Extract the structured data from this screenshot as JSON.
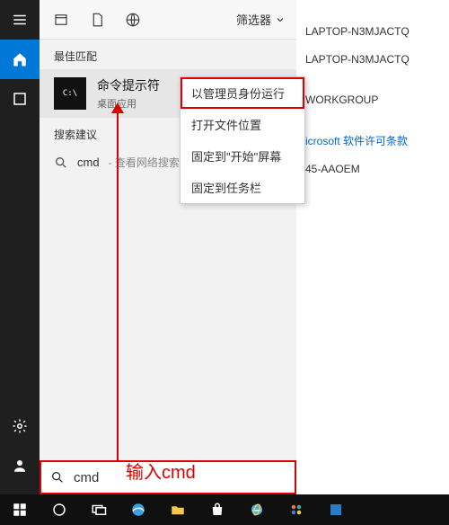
{
  "bg": {
    "line1": "LAPTOP-N3MJACTQ",
    "line2": "LAPTOP-N3MJACTQ",
    "line3": "WORKGROUP",
    "line4_link": "icrosoft 软件许可条款",
    "line5": "45-AAOEM"
  },
  "header": {
    "filter_label": "筛选器"
  },
  "sections": {
    "best_match_title": "最佳匹配",
    "suggestions_title": "搜索建议"
  },
  "best_match": {
    "title": "命令提示符",
    "subtitle": "桌面应用",
    "icon_text": "C:\\"
  },
  "suggestion": {
    "query": "cmd",
    "hint": "- 查看网络搜索结果"
  },
  "context_menu": {
    "items": [
      "以管理员身份运行",
      "打开文件位置",
      "固定到\"开始\"屏幕",
      "固定到任务栏"
    ]
  },
  "search": {
    "value": "cmd"
  },
  "annotation": {
    "text": "输入cmd"
  }
}
